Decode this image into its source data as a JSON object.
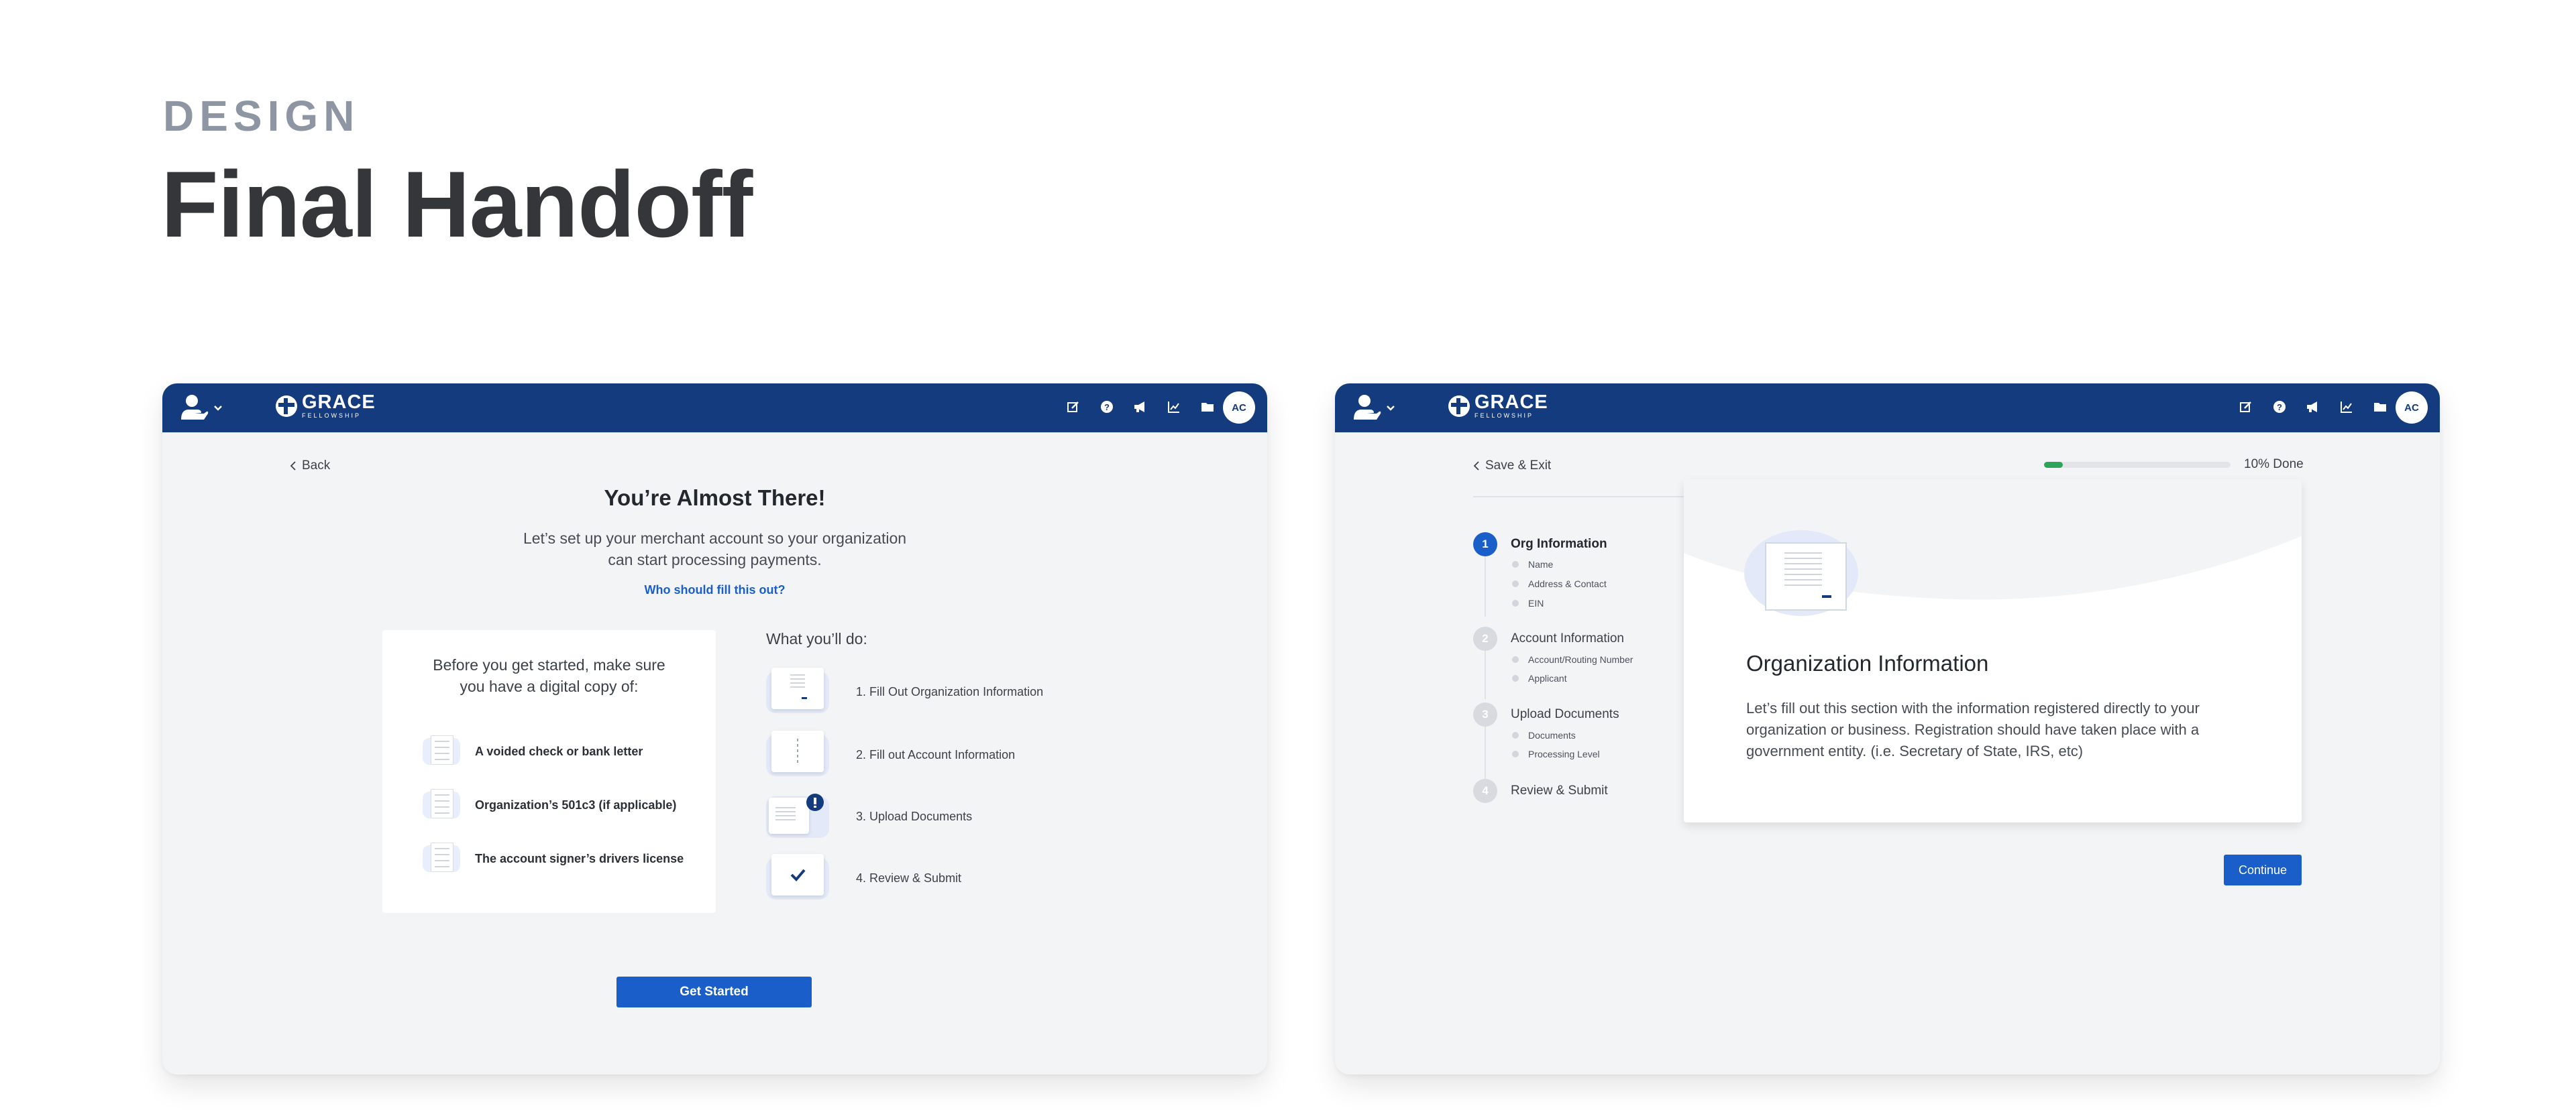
{
  "page": {
    "eyebrow": "DESIGN",
    "headline": "Final Handoff"
  },
  "brand": {
    "name": "GRACE",
    "tagline": "FELLOWSHIP",
    "avatar_initials": "AC",
    "colors": {
      "topbar": "#133b7d",
      "primary": "#1a5fc9",
      "progress": "#2ea35a"
    },
    "icons": [
      "edit-icon",
      "help-icon",
      "megaphone-icon",
      "chart-icon",
      "folder-icon"
    ]
  },
  "screen1": {
    "back_label": "Back",
    "title": "You’re Almost There!",
    "subtitle_line1": "Let’s set up your merchant account so your organization",
    "subtitle_line2": "can start processing payments.",
    "help_link": "Who should fill this out?",
    "requirements": {
      "intro_line1": "Before you get started, make sure",
      "intro_line2": "you have a digital copy of:",
      "items": [
        "A voided check or bank letter",
        "Organization’s 501c3 (if applicable)",
        "The account signer’s drivers license"
      ]
    },
    "todo": {
      "heading": "What you’ll do:",
      "steps": [
        "1. Fill Out Organization Information",
        "2. Fill out Account Information",
        "3. Upload Documents",
        "4. Review & Submit"
      ]
    },
    "cta_label": "Get Started"
  },
  "screen2": {
    "back_label": "Save & Exit",
    "progress_value": 0.1,
    "progress_label": "10% Done",
    "steps": [
      {
        "num": "1",
        "label": "Org Information",
        "subs": [
          "Name",
          "Address & Contact",
          "EIN"
        ]
      },
      {
        "num": "2",
        "label": "Account Information",
        "subs": [
          "Account/Routing Number",
          "Applicant"
        ]
      },
      {
        "num": "3",
        "label": "Upload Documents",
        "subs": [
          "Documents",
          "Processing Level"
        ]
      },
      {
        "num": "4",
        "label": "Review & Submit",
        "subs": []
      }
    ],
    "card_title": "Organization Information",
    "card_body": "Let’s fill out this section with the information registered directly to your organization or business. Registration should have taken place with a government entity. (i.e. Secretary of State, IRS, etc)",
    "continue_label": "Continue"
  }
}
